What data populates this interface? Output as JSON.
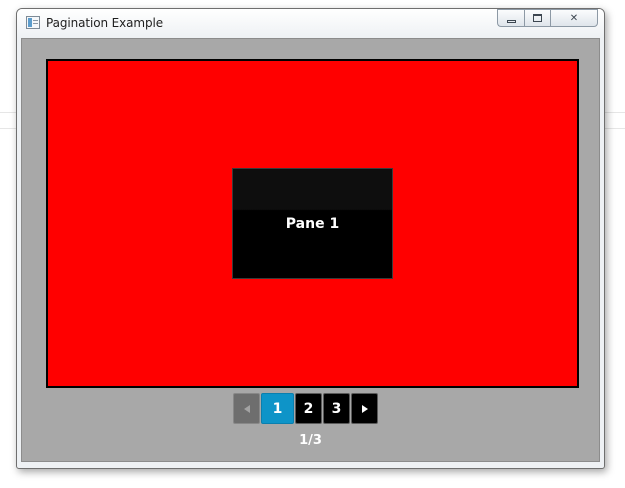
{
  "window": {
    "title": "Pagination Example"
  },
  "content": {
    "pane_label": "Pane 1",
    "page_color": "#ff0000"
  },
  "pagination": {
    "pages": [
      "1",
      "2",
      "3"
    ],
    "current_page": 1,
    "page_count": 3,
    "page_info": "1/3",
    "selected_color": "#0e94c8"
  },
  "icons": {
    "app": "window-app-icon",
    "minimize": "minimize-icon",
    "maximize": "maximize-icon",
    "close": "close-icon",
    "prev": "chevron-left-icon",
    "next": "chevron-right-icon"
  }
}
